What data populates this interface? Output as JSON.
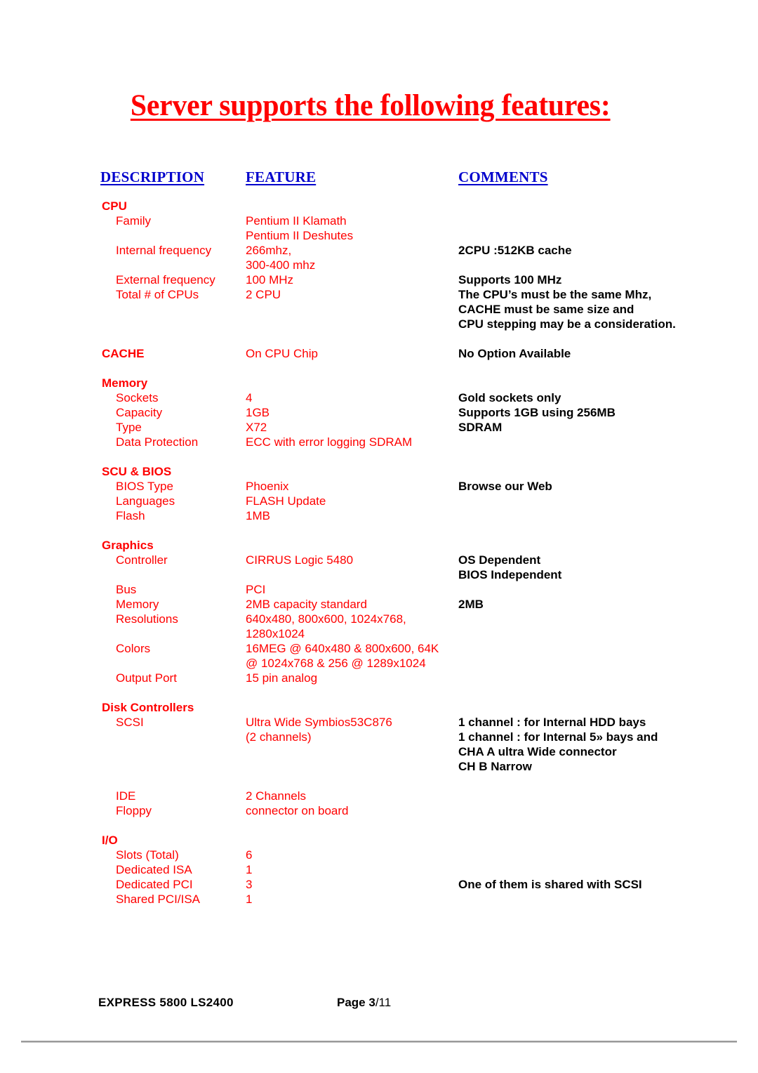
{
  "document": {
    "title": "Server supports the following features:"
  },
  "columns": {
    "description": "DESCRIPTION",
    "feature": "FEATURE",
    "comments": "COMMENTS"
  },
  "colors": {
    "title": "#FF0000",
    "header": "#0000CC",
    "data": "#FF0000",
    "comments": "#000000"
  },
  "rows": [
    {
      "desc": "CPU",
      "feat": "",
      "comm": "",
      "kind": "section"
    },
    {
      "desc": "Family",
      "feat": "Pentium II Klamath",
      "comm": "",
      "kind": "item"
    },
    {
      "desc": "",
      "feat": "Pentium II Deshutes",
      "comm": "",
      "kind": "cont"
    },
    {
      "desc": "Internal frequency",
      "feat": "266mhz,",
      "comm": "2CPU :512KB cache",
      "kind": "item"
    },
    {
      "desc": "",
      "feat": "300-400 mhz",
      "comm": "",
      "kind": "cont"
    },
    {
      "desc": "External frequency",
      "feat": "100 MHz",
      "comm": "Supports 100 MHz",
      "kind": "item"
    },
    {
      "desc": "Total  # of CPUs",
      "feat": "2 CPU",
      "comm": "The CPU’s must be the same Mhz,",
      "kind": "item"
    },
    {
      "desc": "",
      "feat": "",
      "comm": "CACHE must be same size and",
      "kind": "cont"
    },
    {
      "desc": "",
      "feat": "",
      "comm": "CPU stepping may be a consideration.",
      "kind": "cont"
    },
    {
      "desc": "",
      "feat": "",
      "comm": "",
      "kind": "spacer"
    },
    {
      "desc": "CACHE",
      "feat": " On CPU Chip",
      "comm": "No Option Available",
      "kind": "section"
    },
    {
      "desc": "",
      "feat": "",
      "comm": "",
      "kind": "spacer"
    },
    {
      "desc": "Memory",
      "feat": "",
      "comm": "",
      "kind": "section"
    },
    {
      "desc": "Sockets",
      "feat": "4",
      "comm": "Gold sockets only",
      "kind": "item"
    },
    {
      "desc": "Capacity",
      "feat": "1GB",
      "comm": "Supports 1GB using 256MB",
      "kind": "item"
    },
    {
      "desc": "Type",
      "feat": "X72",
      "comm": "SDRAM",
      "kind": "item"
    },
    {
      "desc": " Data Protection",
      "feat": "ECC with error logging SDRAM",
      "comm": "",
      "kind": "item"
    },
    {
      "desc": "",
      "feat": "",
      "comm": "",
      "kind": "spacer"
    },
    {
      "desc": "SCU & BIOS",
      "feat": "",
      "comm": "",
      "kind": "section"
    },
    {
      "desc": "BIOS Type",
      "feat": "Phoenix",
      "comm": "Browse our Web",
      "kind": "item"
    },
    {
      "desc": "Languages",
      "feat": "FLASH Update",
      "comm": "",
      "kind": "item"
    },
    {
      "desc": "Flash",
      "feat": "1MB",
      "comm": "",
      "kind": "item"
    },
    {
      "desc": "",
      "feat": "",
      "comm": "",
      "kind": "spacer"
    },
    {
      "desc": "Graphics",
      "feat": "",
      "comm": "",
      "kind": "section"
    },
    {
      "desc": "Controller",
      "feat": "CIRRUS Logic 5480",
      "comm": "OS Dependent",
      "kind": "item"
    },
    {
      "desc": "",
      "feat": "",
      "comm": "BIOS Independent",
      "kind": "cont"
    },
    {
      "desc": "Bus",
      "feat": "PCI",
      "comm": "",
      "kind": "item"
    },
    {
      "desc": "Memory",
      "feat": "2MB capacity standard",
      "comm": "2MB",
      "kind": "item"
    },
    {
      "desc": "Resolutions",
      "feat": "640x480, 800x600, 1024x768,",
      "comm": "",
      "kind": "item"
    },
    {
      "desc": "",
      "feat": "1280x1024",
      "comm": "",
      "kind": "cont"
    },
    {
      "desc": "Colors",
      "feat": "16MEG @ 640x480 & 800x600, 64K",
      "comm": "",
      "kind": "item-clip"
    },
    {
      "desc": "",
      "feat": "@ 1024x768 & 256 @ 1289x1024",
      "comm": "",
      "kind": "cont"
    },
    {
      "desc": "Output Port",
      "feat": "15 pin analog",
      "comm": "",
      "kind": "item"
    },
    {
      "desc": "",
      "feat": "",
      "comm": "",
      "kind": "spacer"
    },
    {
      "desc": "Disk Controllers",
      "feat": "",
      "comm": "",
      "kind": "section"
    },
    {
      "desc": "SCSI",
      "feat": "Ultra Wide Symbios53C876",
      "comm": "1 channel : for Internal HDD bays",
      "kind": "item"
    },
    {
      "desc": "",
      "feat": " (2 channels)",
      "comm": "1 channel : for Internal 5» bays and",
      "kind": "cont"
    },
    {
      "desc": "",
      "feat": "",
      "comm": "CHA A ultra Wide connector",
      "kind": "cont"
    },
    {
      "desc": "",
      "feat": "",
      "comm": "CH B Narrow",
      "kind": "cont"
    },
    {
      "desc": "",
      "feat": "",
      "comm": "",
      "kind": "spacer"
    },
    {
      "desc": "IDE",
      "feat": "2 Channels",
      "comm": "",
      "kind": "item"
    },
    {
      "desc": "Floppy",
      "feat": "connector on board",
      "comm": "",
      "kind": "item"
    },
    {
      "desc": "",
      "feat": "",
      "comm": "",
      "kind": "spacer"
    },
    {
      "desc": "I/O",
      "feat": "",
      "comm": "",
      "kind": "section"
    },
    {
      "desc": "Slots (Total)",
      "feat": "6",
      "comm": "",
      "kind": "item"
    },
    {
      "desc": "Dedicated ISA",
      "feat": "1",
      "comm": "",
      "kind": "item"
    },
    {
      "desc": "Dedicated PCI",
      "feat": "3",
      "comm": "One of them is shared with SCSI",
      "kind": "item"
    },
    {
      "desc": "Shared PCI/ISA",
      "feat": "1",
      "comm": "",
      "kind": "item"
    }
  ],
  "footer": {
    "model": "EXPRESS 5800   LS2400",
    "page_label": "Page 3",
    "page_total": "/11"
  }
}
